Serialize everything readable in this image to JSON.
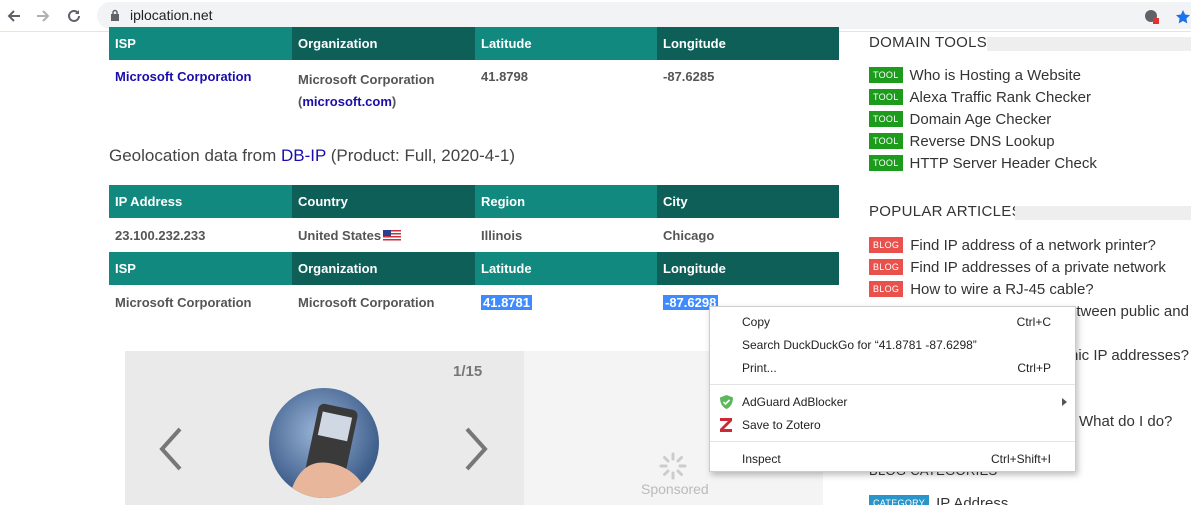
{
  "browser": {
    "url": "iplocation.net"
  },
  "table1": {
    "headers": [
      "ISP",
      "Organization",
      "Latitude",
      "Longitude"
    ],
    "isp": "Microsoft Corporation",
    "org_line1": "Microsoft Corporation",
    "org_paren_open": "(",
    "org_link": "microsoft.com",
    "org_paren_close": ")",
    "latitude": "41.8798",
    "longitude": "-87.6285"
  },
  "dbip": {
    "prefix": "Geolocation data from ",
    "link": "DB-IP",
    "suffix": " (Product: Full, 2020-4-1)"
  },
  "table2": {
    "headers": [
      "IP Address",
      "Country",
      "Region",
      "City"
    ],
    "ip": "23.100.232.233",
    "country": "United States",
    "region": "Illinois",
    "city": "Chicago",
    "headers2": [
      "ISP",
      "Organization",
      "Latitude",
      "Longitude"
    ],
    "isp": "Microsoft Corporation",
    "org": "Microsoft Corporation",
    "latitude": "41.8781",
    "longitude": "-87.6298"
  },
  "carousel": {
    "counter": "1/15",
    "sponsored": "Sponsored"
  },
  "sidebar": {
    "domain_tools_title": "DOMAIN TOOLS",
    "tools": [
      {
        "badge": "TOOL",
        "label": "Who is Hosting a Website"
      },
      {
        "badge": "TOOL",
        "label": "Alexa Traffic Rank Checker"
      },
      {
        "badge": "TOOL",
        "label": "Domain Age Checker"
      },
      {
        "badge": "TOOL",
        "label": "Reverse DNS Lookup"
      },
      {
        "badge": "TOOL",
        "label": "HTTP Server Header Check"
      }
    ],
    "popular_title": "POPULAR ARTICLES",
    "articles": [
      {
        "badge": "BLOG",
        "label": "Find IP address of a network printer?"
      },
      {
        "badge": "BLOG",
        "label": "Find IP addresses of a private network"
      },
      {
        "badge": "BLOG",
        "label": "How to wire a RJ-45 cable?"
      }
    ],
    "partial_texts": [
      "etween public and",
      "nic IP addresses?",
      "What do I do?"
    ],
    "category_title_partial": "BLOG CATEGORIES",
    "category": {
      "badge": "CATEGORY",
      "label": "IP Address"
    }
  },
  "context_menu": {
    "items": [
      {
        "label": "Copy",
        "shortcut": "Ctrl+C"
      },
      {
        "label": "Search DuckDuckGo for “41.8781 -87.6298”",
        "shortcut": ""
      },
      {
        "label": "Print...",
        "shortcut": "Ctrl+P"
      },
      {
        "label": "AdGuard AdBlocker",
        "shortcut": ""
      },
      {
        "label": "Save to Zotero",
        "shortcut": ""
      },
      {
        "label": "Inspect",
        "shortcut": "Ctrl+Shift+I"
      }
    ]
  }
}
